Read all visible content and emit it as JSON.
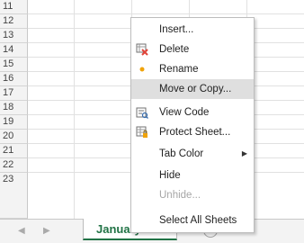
{
  "rows": [
    "11",
    "12",
    "13",
    "14",
    "15",
    "16",
    "17",
    "18",
    "19",
    "20",
    "21",
    "22",
    "23"
  ],
  "context_menu": {
    "items": [
      {
        "label": "Insert...",
        "icon": "none",
        "selected": false,
        "disabled": false,
        "submenu": false
      },
      {
        "label": "Delete",
        "icon": "delete-sheet-icon",
        "selected": false,
        "disabled": false,
        "submenu": false
      },
      {
        "label": "Rename",
        "icon": "rename-dot-icon",
        "selected": false,
        "disabled": false,
        "submenu": false
      },
      {
        "label": "Move or Copy...",
        "icon": "none",
        "selected": true,
        "disabled": false,
        "submenu": false
      },
      {
        "label": "View Code",
        "icon": "view-code-icon",
        "selected": false,
        "disabled": false,
        "submenu": false
      },
      {
        "label": "Protect Sheet...",
        "icon": "protect-sheet-icon",
        "selected": false,
        "disabled": false,
        "submenu": false
      },
      {
        "label": "Tab Color",
        "icon": "none",
        "selected": false,
        "disabled": false,
        "submenu": true
      },
      {
        "label": "Hide",
        "icon": "none",
        "selected": false,
        "disabled": false,
        "submenu": false
      },
      {
        "label": "Unhide...",
        "icon": "none",
        "selected": false,
        "disabled": true,
        "submenu": false
      },
      {
        "label": "Select All Sheets",
        "icon": "none",
        "selected": false,
        "disabled": false,
        "submenu": false
      }
    ]
  },
  "sheet_tabs": {
    "active": "January Data",
    "add_glyph": "+",
    "prev_glyph": "◀",
    "next_glyph": "▶"
  },
  "colors": {
    "accent": "#217346",
    "menu_selected": "#dfdfdf",
    "rename_dot": "#f0a30a",
    "delete_x": "#e0443a"
  }
}
